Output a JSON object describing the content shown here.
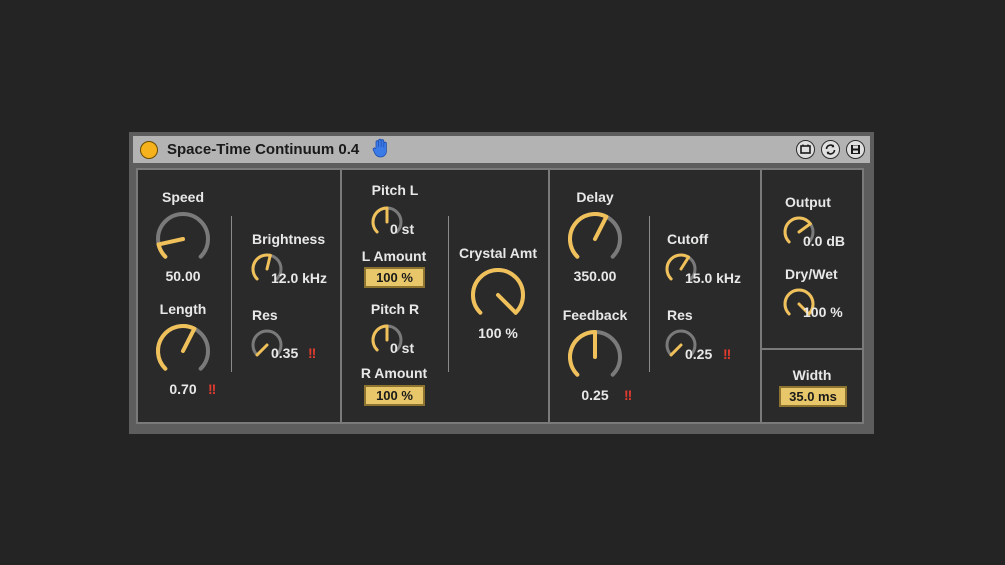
{
  "device": {
    "title": "Space-Time Continuum 0.4",
    "power_on": true
  },
  "colors": {
    "accent": "#f5b21c",
    "knob_arc": "#f0c15a",
    "knob_track": "#7a7a7a",
    "numbox_bg": "#e8c76a",
    "panel_bg": "#2a2a2a",
    "title_bg": "#b3b3b3",
    "warn": "#e23b2e"
  },
  "icons": {
    "hand": "hand-icon",
    "buttons": [
      "map-icon",
      "hot-swap-icon",
      "save-icon"
    ]
  },
  "controls": {
    "speed": {
      "label": "Speed",
      "value": "50.00",
      "level": 0.12
    },
    "length": {
      "label": "Length",
      "value": "0.70",
      "level": 0.6,
      "warn": "!!"
    },
    "brightness": {
      "label": "Brightness",
      "value": "12.0 kHz",
      "level": 0.55
    },
    "res1": {
      "label": "Res",
      "value": "0.35",
      "level": 0.0,
      "warn": "!!"
    },
    "pitch_l": {
      "label": "Pitch L",
      "value": "0 st",
      "level": 0.5
    },
    "l_amount": {
      "label": "L Amount",
      "value": "100 %"
    },
    "pitch_r": {
      "label": "Pitch R",
      "value": "0 st",
      "level": 0.5
    },
    "r_amount": {
      "label": "R Amount",
      "value": "100 %"
    },
    "crystal": {
      "label": "Crystal Amt",
      "value": "100 %",
      "level": 1.0
    },
    "delay": {
      "label": "Delay",
      "value": "350.00",
      "level": 0.6
    },
    "feedback": {
      "label": "Feedback",
      "value": "0.25",
      "level": 0.5,
      "warn": "!!"
    },
    "cutoff": {
      "label": "Cutoff",
      "value": "15.0 kHz",
      "level": 0.62
    },
    "res2": {
      "label": "Res",
      "value": "0.25",
      "level": 0.0,
      "warn": "!!"
    },
    "output": {
      "label": "Output",
      "value": "0.0 dB",
      "level": 0.7
    },
    "drywet": {
      "label": "Dry/Wet",
      "value": "100 %",
      "level": 1.0
    },
    "width": {
      "label": "Width",
      "value": "35.0 ms"
    }
  }
}
